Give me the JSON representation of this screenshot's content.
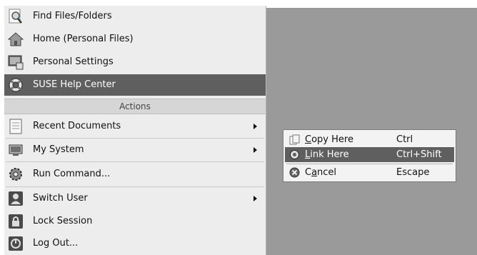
{
  "menu": {
    "items": [
      {
        "label": "Find Files/Folders",
        "icon": "magnifier-icon"
      },
      {
        "label": "Home (Personal Files)",
        "icon": "home-icon"
      },
      {
        "label": "Personal Settings",
        "icon": "settings-icon"
      },
      {
        "label": "SUSE Help Center",
        "icon": "lifebuoy-icon",
        "highlighted": true
      }
    ],
    "section_header": "Actions",
    "actions": [
      {
        "label": "Recent Documents",
        "icon": "document-icon",
        "submenu": true
      },
      {
        "label": "My System",
        "icon": "computer-icon",
        "submenu": true
      },
      {
        "label": "Run Command...",
        "icon": "gear-icon"
      },
      {
        "label": "Switch User",
        "icon": "user-icon",
        "submenu": true
      },
      {
        "label": "Lock Session",
        "icon": "lock-icon"
      },
      {
        "label": "Log Out...",
        "icon": "power-icon"
      }
    ]
  },
  "context_menu": {
    "items": [
      {
        "pre": "",
        "mnemonic": "C",
        "post": "opy Here",
        "shortcut": "Ctrl",
        "icon": "copy-icon"
      },
      {
        "pre": "",
        "mnemonic": "L",
        "post": "ink Here",
        "shortcut": "Ctrl+Shift",
        "icon": "link-icon",
        "highlighted": true
      },
      {
        "pre": "C",
        "mnemonic": "a",
        "post": "ncel",
        "shortcut": "Escape",
        "icon": "cancel-icon"
      }
    ]
  },
  "colors": {
    "desktop": "#9a9a9a",
    "highlight": "#5f5f5f",
    "menu_bg": "#ededed"
  }
}
